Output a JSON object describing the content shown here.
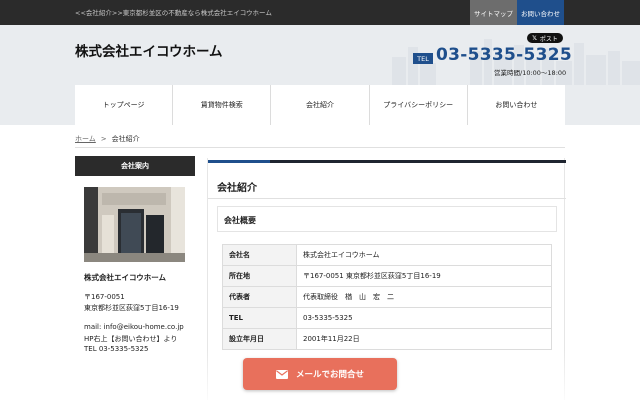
{
  "topbar": {
    "breadcrumb_text": "<<会社紹介>>東京都杉並区の不動産なら株式会社エイコウホーム",
    "sitemap_label": "サイトマップ",
    "contact_label": "お問い合わせ"
  },
  "header": {
    "company_name": "株式会社エイコウホーム",
    "post_label": "ポスト",
    "tel_label": "TEL",
    "tel_number": "03-5335-5325",
    "hours": "営業時間/10:00～18:00"
  },
  "nav": {
    "items": [
      {
        "label": "トップページ"
      },
      {
        "label": "賃貸物件検索"
      },
      {
        "label": "会社紹介"
      },
      {
        "label": "プライバシーポリシー"
      },
      {
        "label": "お問い合わせ"
      }
    ]
  },
  "breadcrumb": {
    "home": "ホーム",
    "separator": ">",
    "current": "会社紹介"
  },
  "sidebar": {
    "heading": "会社案内",
    "company_name": "株式会社エイコウホーム",
    "postal": "〒167-0051",
    "address": "東京都杉並区荻窪5丁目16-19",
    "mail": "mail: info@eikou-home.co.jp",
    "hp_note": "HP右上【お問い合わせ】より",
    "tel": "TEL 03-5335-5325"
  },
  "main": {
    "page_title": "会社紹介",
    "section_title": "会社概要",
    "rows": [
      {
        "label": "会社名",
        "value": "株式会社エイコウホーム"
      },
      {
        "label": "所在地",
        "value": "〒167-0051 東京都杉並区荻窪5丁目16-19"
      },
      {
        "label": "代表者",
        "value": "代表取締役　楢　山　宏　二"
      },
      {
        "label": "TEL",
        "value": "03-5335-5325"
      },
      {
        "label": "設立年月日",
        "value": "2001年11月22日"
      }
    ]
  },
  "floating": {
    "mail_button": "メールでお問合せ"
  },
  "colors": {
    "accent_blue": "#1f4f8c",
    "dark": "#2b2b2b",
    "mail_button": "#e8705c"
  }
}
